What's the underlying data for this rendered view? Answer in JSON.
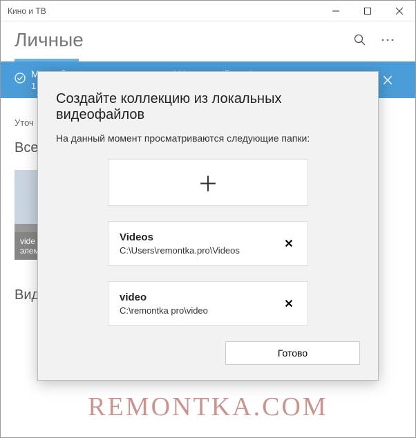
{
  "titlebar": {
    "title": "Кино и ТВ"
  },
  "header": {
    "title": "Личные"
  },
  "banner": {
    "line1": "Мы добавили весь ваш контент! Наслаждайтесь!",
    "line2": "1 видео"
  },
  "content": {
    "refine": "Уточ",
    "section_all": "Все",
    "thumb_caption_l1": "vide",
    "thumb_caption_l2": "элем",
    "section_video": "Видео"
  },
  "watermark": "REMONTKA.COM",
  "modal": {
    "title": "Создайте коллекцию из локальных видеофайлов",
    "subtitle": "На данный момент просматриваются следующие папки:",
    "folders": [
      {
        "name": "Videos",
        "path": "C:\\Users\\remontka.pro\\Videos"
      },
      {
        "name": "video",
        "path": "C:\\remontka pro\\video"
      }
    ],
    "done": "Готово"
  }
}
